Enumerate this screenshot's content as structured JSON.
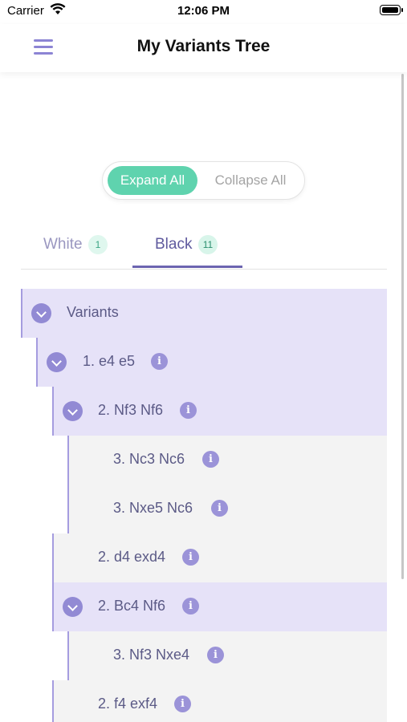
{
  "status_bar": {
    "carrier": "Carrier",
    "time": "12:06 PM"
  },
  "nav": {
    "title": "My Variants Tree",
    "menu_icon": "hamburger-menu-icon"
  },
  "segmented": {
    "expand_label": "Expand All",
    "collapse_label": "Collapse All",
    "selected": "Expand All"
  },
  "tabs": [
    {
      "label": "White",
      "count": "1"
    },
    {
      "label": "Black",
      "count": "11",
      "active": true
    }
  ],
  "tree": {
    "root": "Variants",
    "rows": [
      {
        "label": "1. e4 e5",
        "info": "i"
      },
      {
        "label": "2. Nf3 Nf6",
        "info": "i"
      },
      {
        "label": "3. Nc3 Nc6",
        "info": "i"
      },
      {
        "label": "3. Nxe5 Nc6",
        "info": "i"
      },
      {
        "label": "2. d4 exd4",
        "info": "i"
      },
      {
        "label": "2. Bc4 Nf6",
        "info": "i"
      },
      {
        "label": "3. Nf3 Nxe4",
        "info": "i"
      },
      {
        "label": "2. f4 exf4",
        "info": "i"
      }
    ]
  },
  "colors": {
    "accent": "#8c84d4",
    "expand_button": "#5fd3ae",
    "expanded_row": "#e6e2f8",
    "leaf_row": "#f3f3f3",
    "badge_bg": "#dff7ee"
  }
}
